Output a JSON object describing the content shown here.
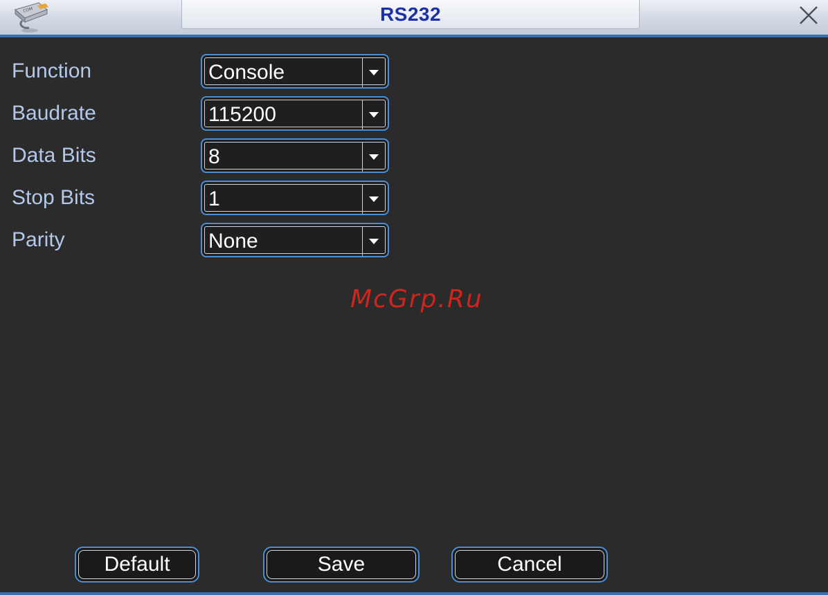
{
  "window": {
    "title": "RS232",
    "icon": "com-port-icon",
    "close_icon": "close-icon"
  },
  "fields": [
    {
      "label": "Function",
      "value": "Console"
    },
    {
      "label": "Baudrate",
      "value": "115200"
    },
    {
      "label": "Data Bits",
      "value": "8"
    },
    {
      "label": "Stop Bits",
      "value": "1"
    },
    {
      "label": "Parity",
      "value": "None"
    }
  ],
  "watermark": "McGrp.Ru",
  "buttons": {
    "default_label": "Default",
    "save_label": "Save",
    "cancel_label": "Cancel"
  },
  "colors": {
    "accent": "#4a8fd8",
    "label_text": "#b4c8ea",
    "title_text": "#1a2fa8",
    "background": "#2b2b2b",
    "watermark": "#d0241c"
  }
}
